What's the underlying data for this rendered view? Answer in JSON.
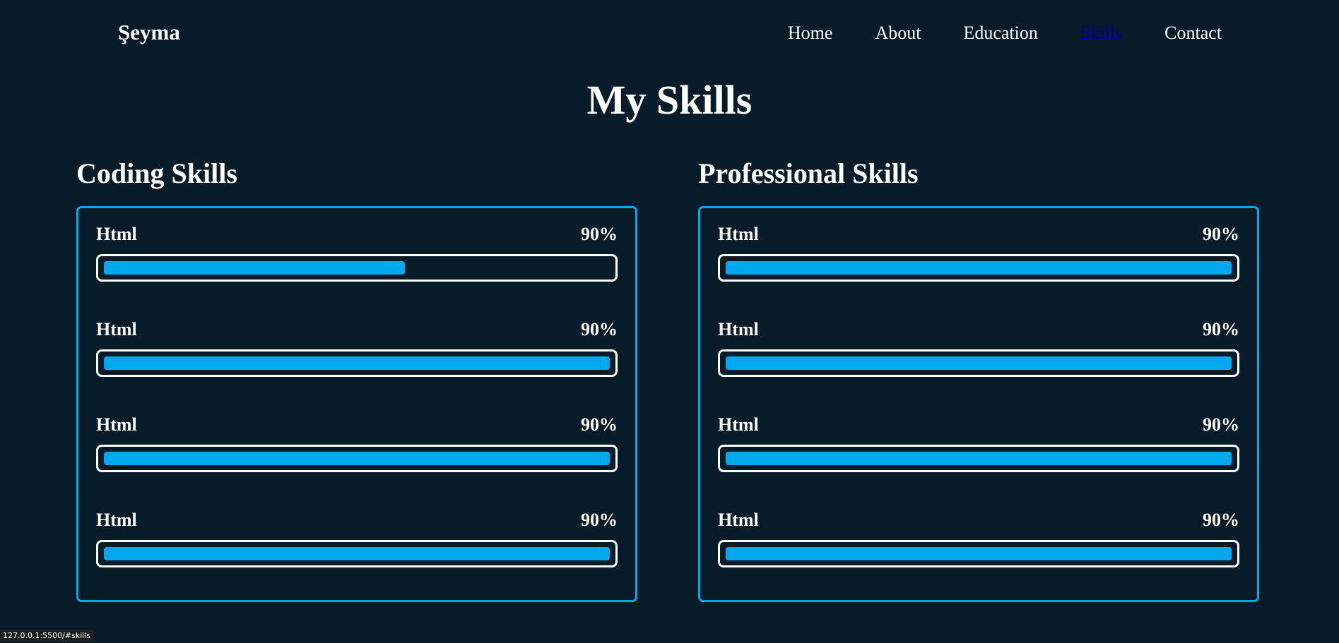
{
  "header": {
    "logo": "Şeyma",
    "nav": [
      {
        "label": "Home",
        "active": false
      },
      {
        "label": "About",
        "active": false
      },
      {
        "label": "Education",
        "active": false
      },
      {
        "label": "Skills",
        "active": true
      },
      {
        "label": "Contact",
        "active": false
      }
    ]
  },
  "title": "My Skills",
  "coding": {
    "title": "Coding Skills",
    "skills": [
      {
        "name": "Html",
        "percent_label": "90%",
        "fill": 0.595
      },
      {
        "name": "Html",
        "percent_label": "90%",
        "fill": 1.0
      },
      {
        "name": "Html",
        "percent_label": "90%",
        "fill": 1.0
      },
      {
        "name": "Html",
        "percent_label": "90%",
        "fill": 1.0
      }
    ]
  },
  "professional": {
    "title": "Professional Skills",
    "skills": [
      {
        "name": "Html",
        "percent_label": "90%",
        "fill": 1.0
      },
      {
        "name": "Html",
        "percent_label": "90%",
        "fill": 1.0
      },
      {
        "name": "Html",
        "percent_label": "90%",
        "fill": 1.0
      },
      {
        "name": "Html",
        "percent_label": "90%",
        "fill": 1.0
      }
    ]
  },
  "status_bar": "127.0.0.1:5500/#skills",
  "colors": {
    "background": "#081b29",
    "accent": "#00a8f0",
    "active_nav": "#0000aa"
  }
}
